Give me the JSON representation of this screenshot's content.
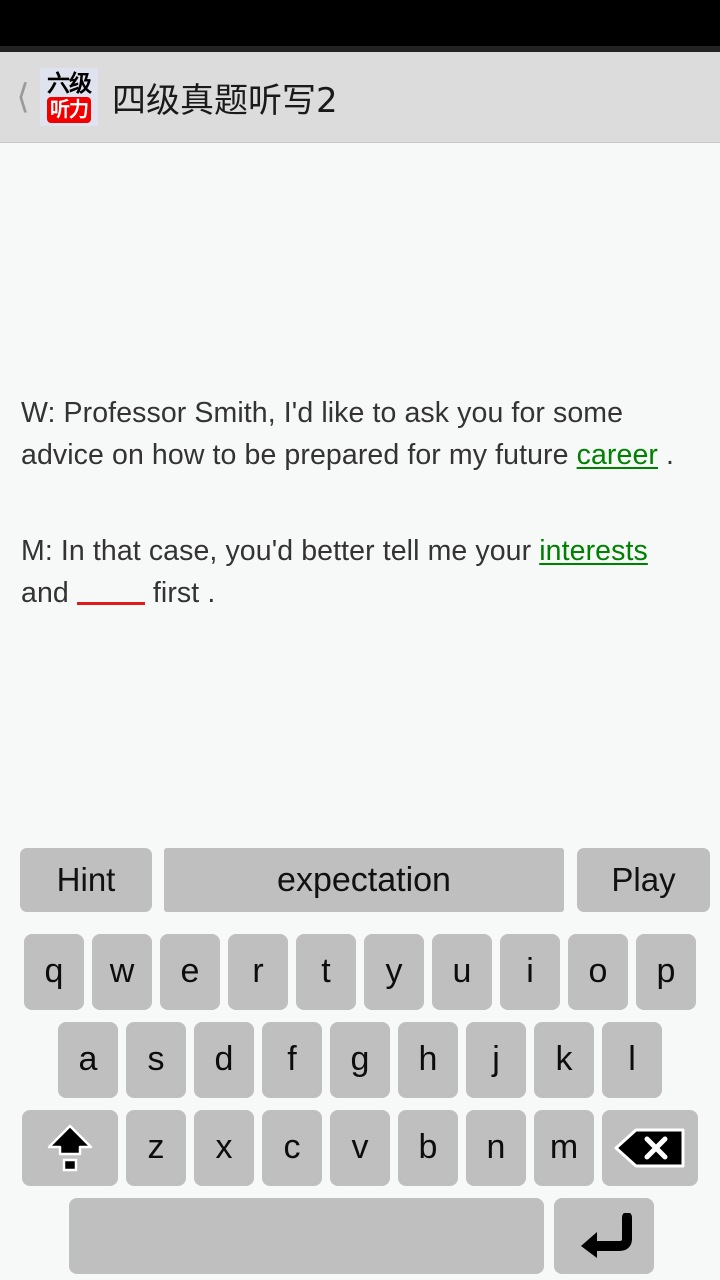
{
  "status_bar": {
    "items": []
  },
  "header": {
    "back_icon": "chevron-left-icon",
    "app_icon": {
      "line1": "六级",
      "line2": "听力"
    },
    "title": "四级真题听写2"
  },
  "transcript": {
    "paragraphs": [
      {
        "speaker": "W:",
        "segments": [
          {
            "type": "text",
            "value": "W: Professor Smith, I'd like to ask you for some advice on how to be prepared for my future "
          },
          {
            "type": "filled",
            "value": "career"
          },
          {
            "type": "text",
            "value": " ."
          }
        ]
      },
      {
        "speaker": "M:",
        "segments": [
          {
            "type": "text",
            "value": "M: In that case, you'd better tell me your "
          },
          {
            "type": "filled",
            "value": "interests"
          },
          {
            "type": "text",
            "value": " and "
          },
          {
            "type": "blank",
            "value": ""
          },
          {
            "type": "text",
            "value": " first ."
          }
        ]
      }
    ],
    "p1_prefix": "W: Professor Smith, I'd like to ask you for some advice on how to be prepared for my future ",
    "p1_filled": "career",
    "p1_suffix": " .",
    "p2_prefix": "M: In that case, you'd better tell me your ",
    "p2_filled": "interests",
    "p2_mid": " and ",
    "p2_suffix": " first ."
  },
  "action_bar": {
    "hint_label": "Hint",
    "suggestion_label": "expectation",
    "play_label": "Play"
  },
  "keyboard": {
    "row1": [
      "q",
      "w",
      "e",
      "r",
      "t",
      "y",
      "u",
      "i",
      "o",
      "p"
    ],
    "row2": [
      "a",
      "s",
      "d",
      "f",
      "g",
      "h",
      "j",
      "k",
      "l"
    ],
    "row3": [
      "z",
      "x",
      "c",
      "v",
      "b",
      "n",
      "m"
    ],
    "shift_icon": "shift-icon",
    "backspace_icon": "backspace-icon",
    "space_label": "",
    "enter_icon": "enter-icon"
  },
  "colors": {
    "status_bar": "#000000",
    "header_bg": "#dcdcdc",
    "content_bg": "#f7f8f8",
    "key_bg": "#bfbfbf",
    "filled_word": "#008000",
    "blank_underline": "#e01b1b",
    "icon_red": "#f20000",
    "body_text": "#333333"
  }
}
